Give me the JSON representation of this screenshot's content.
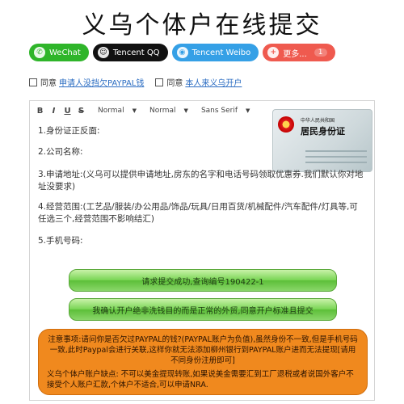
{
  "page": {
    "title": "义乌个体户在线提交"
  },
  "share": {
    "wechat": "WeChat",
    "qq": "Tencent QQ",
    "weibo": "Tencent Weibo",
    "more": "更多...",
    "more_count": "1"
  },
  "agreements": [
    {
      "prefix": "同意",
      "link": "申请人没挡欠PAYPAL钱"
    },
    {
      "prefix": "同意",
      "link": "本人来义乌开户"
    }
  ],
  "toolbar": {
    "bold": "B",
    "italic": "I",
    "underline": "U",
    "strike": "S",
    "size1": "Normal",
    "size2": "Normal",
    "font": "Sans Serif"
  },
  "form": {
    "line1": "1.身份证正反面:",
    "line2": "2.公司名称:",
    "line3": "3.申请地址:(义乌可以提供申请地址,房东的名字和电话号码领取优惠券.我们默认你对地址没要求)",
    "line4": "4.经营范围:(工艺品/服装/办公用品/饰品/玩具/日用百货/机械配件/汽车配件/灯具等,可任选三个,经营范围不影响结汇)",
    "line5": "5.手机号码:"
  },
  "id_card": {
    "country": "中华人民共和国",
    "label": "居民身份证"
  },
  "buttons": {
    "submit_status": "请求提交成功,查询编号190422-1",
    "confirm": "我确认开户绝非洗钱目的而是正常的外贸,同意开户标准且提交"
  },
  "notice": {
    "p1": "注意事项:请问你是否欠过PAYPAL的钱?(PAYPAL账户为负值),虽然身份不一致,但是手机号码一致,此时Paypal会进行关联,这样你就无法添加柳州银行到PAYPAL账户进而无法提现[请用不同身份注册即可]",
    "p2": "义乌个体户账户缺点: 不可以美金提现转账,如果说美金需要汇到工厂退税或者说国外客户不接受个人账户汇款,个体户不适合,可以申请NRA."
  },
  "colors": {
    "wechat": "#2fb52a",
    "qq": "#111111",
    "weibo": "#35a0e6",
    "more": "#ef5a4f",
    "notice": "#f0891e",
    "link": "#2a6cc2"
  }
}
